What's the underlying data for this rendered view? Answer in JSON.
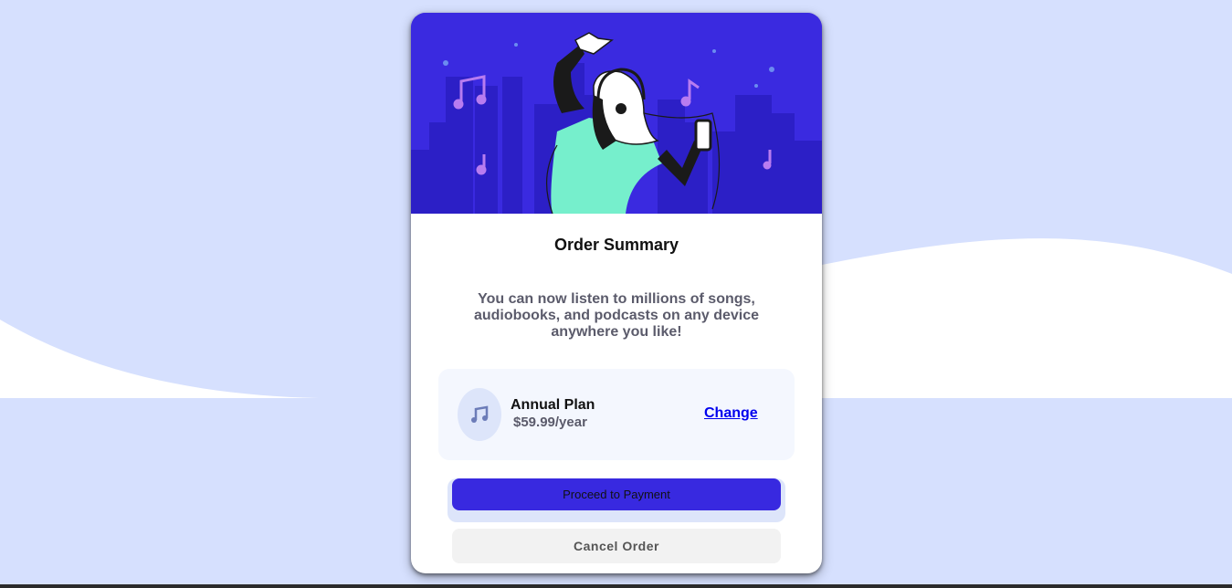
{
  "card": {
    "title": "Order Summary",
    "description": "You can now listen to millions of songs, audiobooks, and podcasts on any device anywhere you like!",
    "plan": {
      "name": "Annual Plan",
      "price": "$59.99/year",
      "change_label": "Change",
      "icon": "music-note-icon"
    },
    "proceed_label": "Proceed to Payment",
    "cancel_label": "Cancel Order"
  },
  "colors": {
    "background": "#d6e0fe",
    "hero": "#3a2ae0",
    "accent": "#3829e0",
    "plan_box": "#f4f7fe"
  }
}
